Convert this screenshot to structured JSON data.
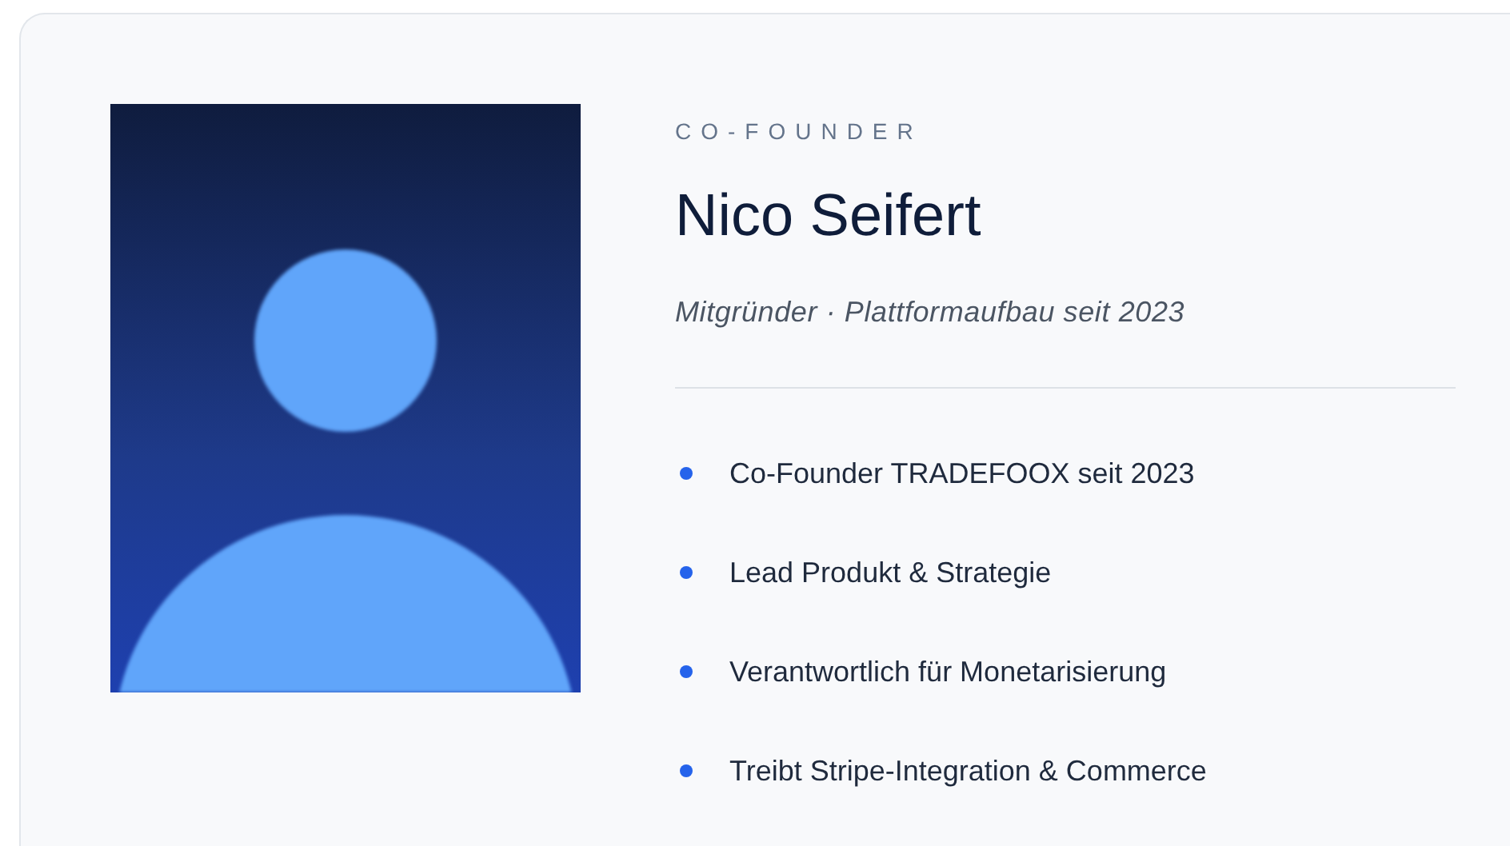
{
  "profile": {
    "eyebrow": "CO-FOUNDER",
    "name": "Nico Seifert",
    "subtitle": "Mitgründer · Plattformaufbau seit 2023",
    "highlights": [
      "Co-Founder TRADEFOOX seit 2023",
      "Lead Produkt & Strategie",
      "Verantwortlich für Monetarisierung",
      "Treibt Stripe-Integration & Commerce"
    ]
  }
}
